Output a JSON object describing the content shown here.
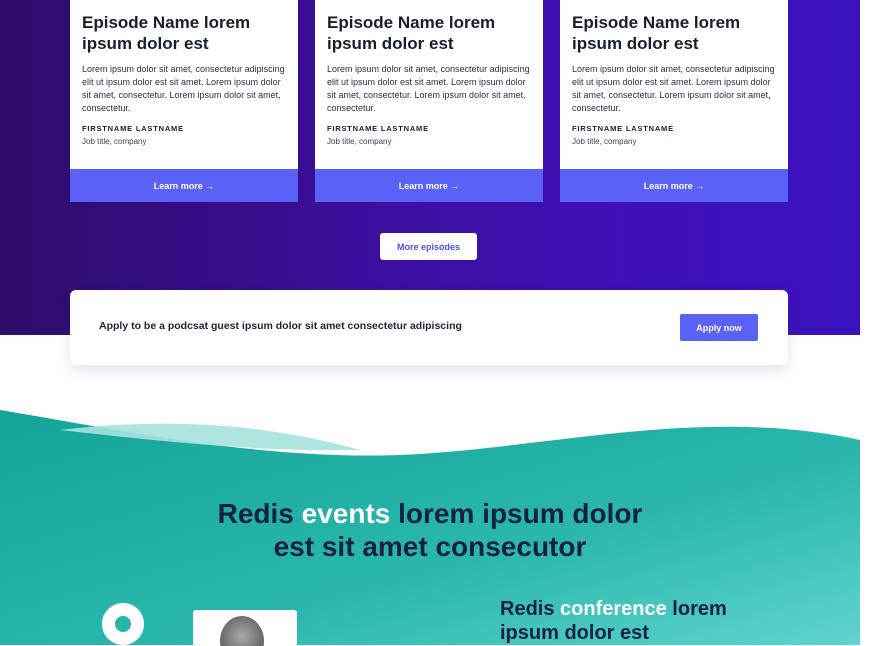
{
  "episodes": [
    {
      "title": "Episode Name lorem ipsum dolor est",
      "description": "Lorem ipsum dolor sit amet, consectetur adipiscing elit ut ipsum dolor est sit amet. Lorem ipsum dolor sit amet, consectetur. Lorem ipsum dolor sit amet, consectetur.",
      "guest_name": "FIRSTNAME LASTNAME",
      "guest_job": "Job title, company",
      "cta": "Learn more →"
    },
    {
      "title": "Episode Name lorem ipsum dolor est",
      "description": "Lorem ipsum dolor sit amet, consectetur adipiscing elit ut ipsum dolor est sit amet. Lorem ipsum dolor sit amet, consectetur. Lorem ipsum dolor sit amet, consectetur.",
      "guest_name": "FIRSTNAME LASTNAME",
      "guest_job": "Job title, company",
      "cta": "Learn more →"
    },
    {
      "title": "Episode Name lorem ipsum dolor est",
      "description": "Lorem ipsum dolor sit amet, consectetur adipiscing elit ut ipsum dolor est sit amet. Lorem ipsum dolor sit amet, consectetur. Lorem ipsum dolor sit amet, consectetur.",
      "guest_name": "FIRSTNAME LASTNAME",
      "guest_job": "Job title, company",
      "cta": "Learn more →"
    }
  ],
  "more_episodes_label": "More episodes",
  "apply": {
    "text": "Apply to be a podcsat guest  ipsum dolor sit amet consectetur adipiscing",
    "button_label": "Apply now"
  },
  "events": {
    "title_prefix": "Redis ",
    "title_highlight": "events",
    "title_line1_rest": " lorem ipsum dolor",
    "title_line2": "est sit amet consecutor"
  },
  "conference": {
    "title_prefix": "Redis ",
    "title_highlight": "conference",
    "title_line1_rest": " lorem",
    "title_line2": "ipsum dolor est"
  },
  "colors": {
    "purple_dark": "#2e0d6a",
    "purple": "#3f11b5",
    "accent_button": "#5961f6",
    "teal_dark": "#1aa89a",
    "teal_light": "#4ecbc6",
    "navy_text": "#14213d"
  }
}
